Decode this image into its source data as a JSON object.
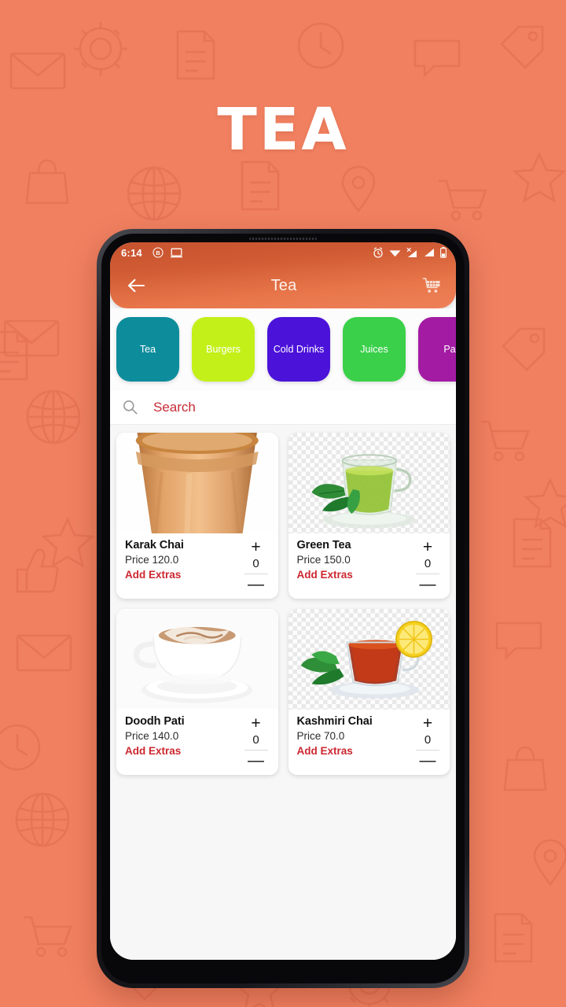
{
  "promo": {
    "title": "TEA",
    "background_color": "#f08060",
    "title_color": "#ffffff"
  },
  "status_bar": {
    "time": "6:14",
    "left_icons": [
      "circled-b-icon",
      "cast-screen-icon"
    ],
    "right_icons": [
      "alarm-clock-icon",
      "wifi-icon",
      "signal-no-sim-icon",
      "signal-bars-icon",
      "battery-icon"
    ]
  },
  "app_bar": {
    "title": "Tea",
    "back_icon": "arrow-left-icon",
    "cart_icon": "shopping-cart-icon",
    "gradient_start": "#c75430",
    "gradient_end": "#ee8058"
  },
  "categories": [
    {
      "label": "Tea",
      "color": "#0d8c9c"
    },
    {
      "label": "Burgers",
      "color": "#c4f01a"
    },
    {
      "label": "Cold Drinks",
      "color": "#4b12d9"
    },
    {
      "label": "Juices",
      "color": "#3ad04a"
    },
    {
      "label": "Pa",
      "color": "#a31ba3"
    }
  ],
  "search": {
    "placeholder": "Search",
    "value": "",
    "icon": "search-icon",
    "text_color": "#c62b35"
  },
  "products": [
    {
      "name": "Karak Chai",
      "price_label": "Price 120.0",
      "extras_label": "Add Extras",
      "quantity": "0",
      "image": "karak-chai",
      "transparent_bg": false
    },
    {
      "name": "Green Tea",
      "price_label": "Price 150.0",
      "extras_label": "Add Extras",
      "quantity": "0",
      "image": "green-tea",
      "transparent_bg": true
    },
    {
      "name": "Doodh Pati",
      "price_label": "Price 140.0",
      "extras_label": "Add Extras",
      "quantity": "0",
      "image": "doodh-pati",
      "transparent_bg": false
    },
    {
      "name": "Kashmiri Chai",
      "price_label": "Price 70.0",
      "extras_label": "Add Extras",
      "quantity": "0",
      "image": "kashmiri-chai",
      "transparent_bg": true
    }
  ],
  "stepper": {
    "increment_label": "+",
    "decrement_label": "—"
  }
}
